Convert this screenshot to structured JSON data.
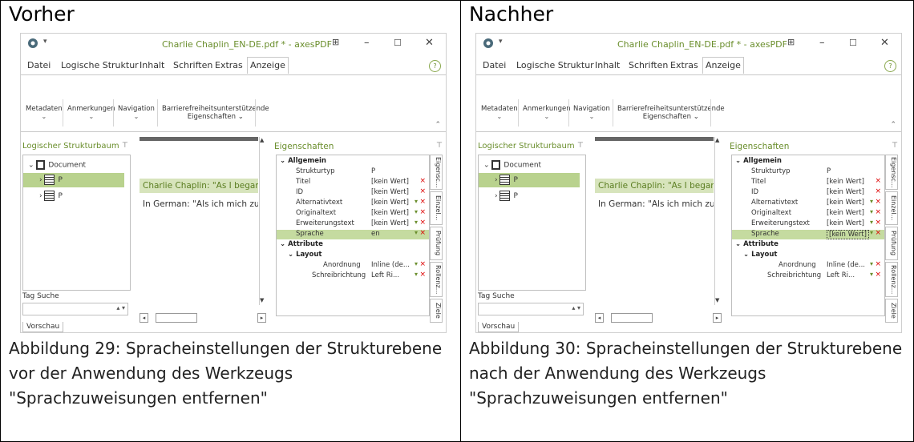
{
  "before": {
    "heading": "Vorher",
    "caption": "Abbildung 29: Spracheinstellungen der Strukturebene vor der Anwendung des Werkzeugs \"Sprachzuweisungen entfernen\"",
    "sprache_value": "en"
  },
  "after": {
    "heading": "Nachher",
    "caption": "Abbildung 30: Spracheinstellungen der Strukturebene nach der Anwendung des Werkzeugs \"Sprachzuweisungen entfernen\"",
    "sprache_value": "[kein Wert]"
  },
  "app": {
    "window_title": "Charlie Chaplin_EN-DE.pdf * - axesPDF",
    "menu": [
      "Datei",
      "Logische Struktur",
      "Inhalt",
      "Schriften",
      "Extras",
      "Anzeige"
    ],
    "ribbon": [
      "Metadaten",
      "Anmerkungen",
      "Navigation",
      "Barrierefreiheitsunterstützende",
      "Eigenschaften"
    ],
    "left_panel_title": "Logischer Strukturbaum",
    "tree": [
      "Document",
      "P",
      "P"
    ],
    "tag_search_label": "Tag Suche",
    "preview_tab": "Vorschau",
    "doc_line1": "Charlie Chaplin: \"As I began to lo",
    "doc_line2": "In German: \"Als ich mich zu liebe",
    "props_title": "Eigenschaften",
    "groups": {
      "allgemein": "Allgemein",
      "attribute": "Attribute",
      "layout": "Layout"
    },
    "props": [
      {
        "k": "Strukturtyp",
        "v": "P"
      },
      {
        "k": "Titel",
        "v": "[kein Wert]"
      },
      {
        "k": "ID",
        "v": "[kein Wert]"
      },
      {
        "k": "Alternativtext",
        "v": "[kein Wert]"
      },
      {
        "k": "Originaltext",
        "v": "[kein Wert]"
      },
      {
        "k": "Erweiterungstext",
        "v": "[kein Wert]"
      },
      {
        "k": "Sprache"
      }
    ],
    "layout_props": [
      {
        "k": "Anordnung",
        "v": "Inline (de..."
      },
      {
        "k": "Schreibrichtung",
        "v": "Left Ri..."
      }
    ],
    "side_tabs": [
      "Eigensc...",
      "Einzel...",
      "Prüfung",
      "Rollenz...",
      "Ziele"
    ],
    "accent_color": "#6a8e2c",
    "selection_color": "#b9d28e"
  }
}
